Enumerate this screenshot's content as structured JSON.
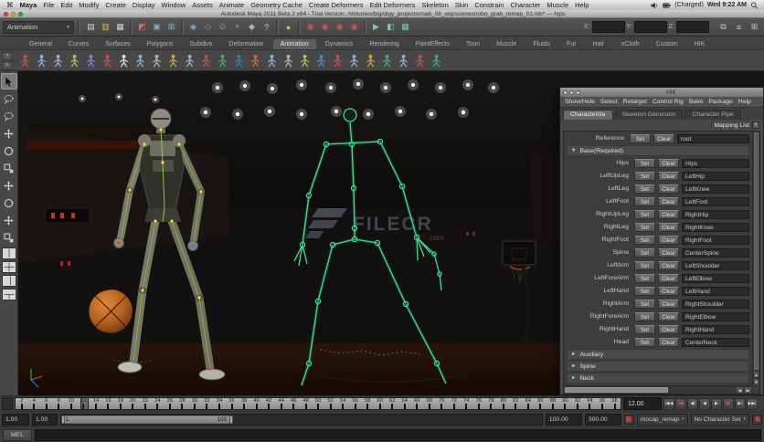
{
  "macos_menubar": {
    "apple_glyph": "⌘",
    "menus": [
      "Maya",
      "File",
      "Edit",
      "Modify",
      "Create",
      "Display",
      "Window",
      "Assets",
      "Animate",
      "Geometry Cache",
      "Create Deformers",
      "Edit Deformers",
      "Skeleton",
      "Skin",
      "Constrain",
      "Character",
      "Muscle",
      "Help"
    ],
    "status": {
      "battery_label": "(Charged)",
      "clock": "Wed 9:22 AM"
    }
  },
  "window_titlebar": {
    "title": "Autodesk Maya 2011 Beta 2 x64 - Trial Version: /Volumes/big/digy_projects/mab_08_wip/scenes/robo_grab_remap_01.mb* --- hips"
  },
  "status_line": {
    "mode_selector": "Animation",
    "dropdown_arrow": "▾",
    "left_icons": [
      {
        "name": "new-scene-icon",
        "glyph": "▤",
        "color": "#cfd3d6"
      },
      {
        "name": "open-scene-icon",
        "glyph": "▥",
        "color": "#d9b35a"
      },
      {
        "name": "save-scene-icon",
        "glyph": "▦",
        "color": "#cfd3d6"
      },
      {
        "name": "select-hierarchy-icon",
        "glyph": "◩",
        "color": "#c77272"
      },
      {
        "name": "select-object-icon",
        "glyph": "▣",
        "color": "#7fa9cd"
      },
      {
        "name": "select-component-icon",
        "glyph": "⊞",
        "color": "#8fb9dd"
      },
      {
        "name": "snap-grid-icon",
        "glyph": "◆",
        "color": "#6f9fc4"
      },
      {
        "name": "snap-curve-icon",
        "glyph": "◇",
        "color": "#6f9fc4"
      },
      {
        "name": "snap-point-icon",
        "glyph": "⊙",
        "color": "#6f9fc4"
      },
      {
        "name": "snap-plane-icon",
        "glyph": "⌖",
        "color": "#6f9fc4"
      },
      {
        "name": "make-live-icon",
        "glyph": "◆",
        "color": "#9fb4c4"
      },
      {
        "name": "help-line-icon",
        "glyph": "?",
        "color": "#c9c9c9"
      },
      {
        "name": "lock-icon",
        "glyph": "●",
        "color": "#d9c13f"
      },
      {
        "name": "input-connections-icon",
        "glyph": "◉",
        "color": "#c75b5b"
      },
      {
        "name": "output-connections-icon",
        "glyph": "◉",
        "color": "#c75b5b"
      },
      {
        "name": "history-icon",
        "glyph": "◉",
        "color": "#c75b5b"
      },
      {
        "name": "construction-history-icon",
        "glyph": "◉",
        "color": "#c75b5b"
      },
      {
        "name": "render-icon",
        "glyph": "▶",
        "color": "#7fc9a0"
      },
      {
        "name": "ipr-render-icon",
        "glyph": "◧",
        "color": "#7fc9a0"
      },
      {
        "name": "render-settings-icon",
        "glyph": "▦",
        "color": "#7fc9a0"
      }
    ],
    "coord_labels": [
      "X:",
      "Y:",
      "Z:"
    ],
    "right_icons": [
      {
        "name": "channel-box-icon",
        "glyph": "⧉",
        "color": "#c9c9c9"
      },
      {
        "name": "layer-editor-icon",
        "glyph": "≡",
        "color": "#c9c9c9"
      },
      {
        "name": "attribute-editor-icon",
        "glyph": "⊞",
        "color": "#c9c9c9"
      }
    ]
  },
  "shelf": {
    "tabs": [
      "General",
      "Curves",
      "Surfaces",
      "Polygons",
      "Subdivs",
      "Deformation",
      "Animation",
      "Dynamics",
      "Rendering",
      "PaintEffects",
      "Toon",
      "Muscle",
      "Fluids",
      "Fur",
      "Hair",
      "nCloth",
      "Custom",
      "HIK"
    ],
    "active_tab": "Animation",
    "icon_colors": [
      "#c0504d",
      "#88b0d8",
      "#88b0d8",
      "#9fc25a",
      "#7f7fd0",
      "#c0504d",
      "#d8d8d8",
      "#88b0d8",
      "#b0b0b0",
      "#c9a23f",
      "#88b0d8",
      "#c0504d",
      "#3fae6b",
      "#2f7fc0",
      "#d06a2c",
      "#88b0d8",
      "#b0b0b0",
      "#9fc25a",
      "#3f8ec9",
      "#c0504d",
      "#88b0d8",
      "#c9a23f",
      "#3fae6b",
      "#88b0d8",
      "#c0504d",
      "#3fae6b"
    ]
  },
  "toolbox": {
    "tools": [
      {
        "name": "select-tool",
        "sym": "sym-cursor",
        "active": true
      },
      {
        "name": "lasso-select-tool",
        "sym": "sym-lasso",
        "active": false
      },
      {
        "name": "paint-select-tool",
        "sym": "sym-lasso",
        "active": false
      },
      {
        "name": "move-tool",
        "sym": "sym-move",
        "active": false
      },
      {
        "name": "rotate-tool",
        "sym": "sym-rotate",
        "active": false
      },
      {
        "name": "scale-tool",
        "sym": "sym-scale",
        "active": false
      },
      {
        "name": "universal-manipulator-tool",
        "sym": "sym-move",
        "active": false
      },
      {
        "name": "soft-modification-tool",
        "sym": "sym-rotate",
        "active": false
      },
      {
        "name": "show-manipulator-tool",
        "sym": "sym-move",
        "active": false
      },
      {
        "name": "last-tool-used",
        "sym": "sym-scale",
        "active": false
      }
    ]
  },
  "hik_panel": {
    "title": "HIK",
    "menus": [
      "Show/Hide",
      "Select",
      "Retarget",
      "Control Rig",
      "Bake",
      "Package",
      "Help"
    ],
    "tabs": [
      "Characterize",
      "Skeleton Generator",
      "Character Pipe"
    ],
    "active_tab": "Characterize",
    "header": "Mapping List",
    "close_glyph": "×",
    "set_label": "Set",
    "clear_label": "Clear",
    "reference_label": "Reference",
    "reference_value": "root",
    "section_label": "Base(Required)",
    "expanded_tri": "▼",
    "collapsed_tri": "►",
    "rows": [
      {
        "label": "Hips",
        "value": "Hips"
      },
      {
        "label": "LeftUpLeg",
        "value": "LeftHip"
      },
      {
        "label": "LeftLeg",
        "value": "LeftKnee"
      },
      {
        "label": "LeftFoot",
        "value": "LeftFoot"
      },
      {
        "label": "RightUpLeg",
        "value": "RightHip"
      },
      {
        "label": "RightLeg",
        "value": "RightKnee"
      },
      {
        "label": "RightFoot",
        "value": "RightFoot"
      },
      {
        "label": "Spine",
        "value": "CenterSpine"
      },
      {
        "label": "LeftArm",
        "value": "LeftShoulder"
      },
      {
        "label": "LeftForeArm",
        "value": "LeftElbow"
      },
      {
        "label": "LeftHand",
        "value": "LeftHand"
      },
      {
        "label": "RightArm",
        "value": "RightShoulder"
      },
      {
        "label": "RightForeArm",
        "value": "RightElbow"
      },
      {
        "label": "RightHand",
        "value": "RightHand"
      },
      {
        "label": "Head",
        "value": "CenterNeck"
      }
    ],
    "collapsed_sections": [
      "Auxiliary",
      "Spine",
      "Neck"
    ]
  },
  "timeline": {
    "ticks": [
      2,
      4,
      6,
      8,
      10,
      12,
      14,
      16,
      18,
      20,
      22,
      24,
      26,
      28,
      30,
      32,
      34,
      36,
      38,
      40,
      42,
      44,
      46,
      48,
      50,
      52,
      54,
      56,
      58,
      60,
      62,
      64,
      66,
      68,
      70,
      72,
      74,
      76,
      78,
      80,
      82,
      84,
      86,
      88,
      90,
      92,
      94,
      96,
      98
    ],
    "current_time": "12.00",
    "playback_buttons": [
      {
        "name": "go-to-start-button",
        "glyph": "|◀◀",
        "red": false
      },
      {
        "name": "step-back-key-button",
        "glyph": "|◀",
        "red": true
      },
      {
        "name": "step-back-frame-button",
        "glyph": "◀|",
        "red": false
      },
      {
        "name": "play-backwards-button",
        "glyph": "◀",
        "red": false
      },
      {
        "name": "play-forwards-button",
        "glyph": "▶",
        "red": false
      },
      {
        "name": "step-forward-frame-button",
        "glyph": "|▶",
        "red": true
      },
      {
        "name": "step-forward-key-button",
        "glyph": "▶|",
        "red": false
      },
      {
        "name": "go-to-end-button",
        "glyph": "▶▶|",
        "red": false
      }
    ]
  },
  "range_slider": {
    "anim_start": "1.00",
    "playback_start": "1.00",
    "bar_min_label": "1",
    "bar_max_label": "100",
    "playback_end": "100.00",
    "anim_end": "300.00",
    "character_menu": "mocap_remap",
    "character_set": "No Character Set",
    "dropdown_arrow": "▾"
  },
  "command_line": {
    "label": "MEL"
  },
  "watermark": {
    "text": "FILECR",
    "suffix": ".com"
  },
  "theme": {
    "accent_green": "#3ce392",
    "viewport_bg": "#0f0e0d",
    "ball_orange": "#c9742c",
    "ui_bg": "#4a4a4a"
  }
}
